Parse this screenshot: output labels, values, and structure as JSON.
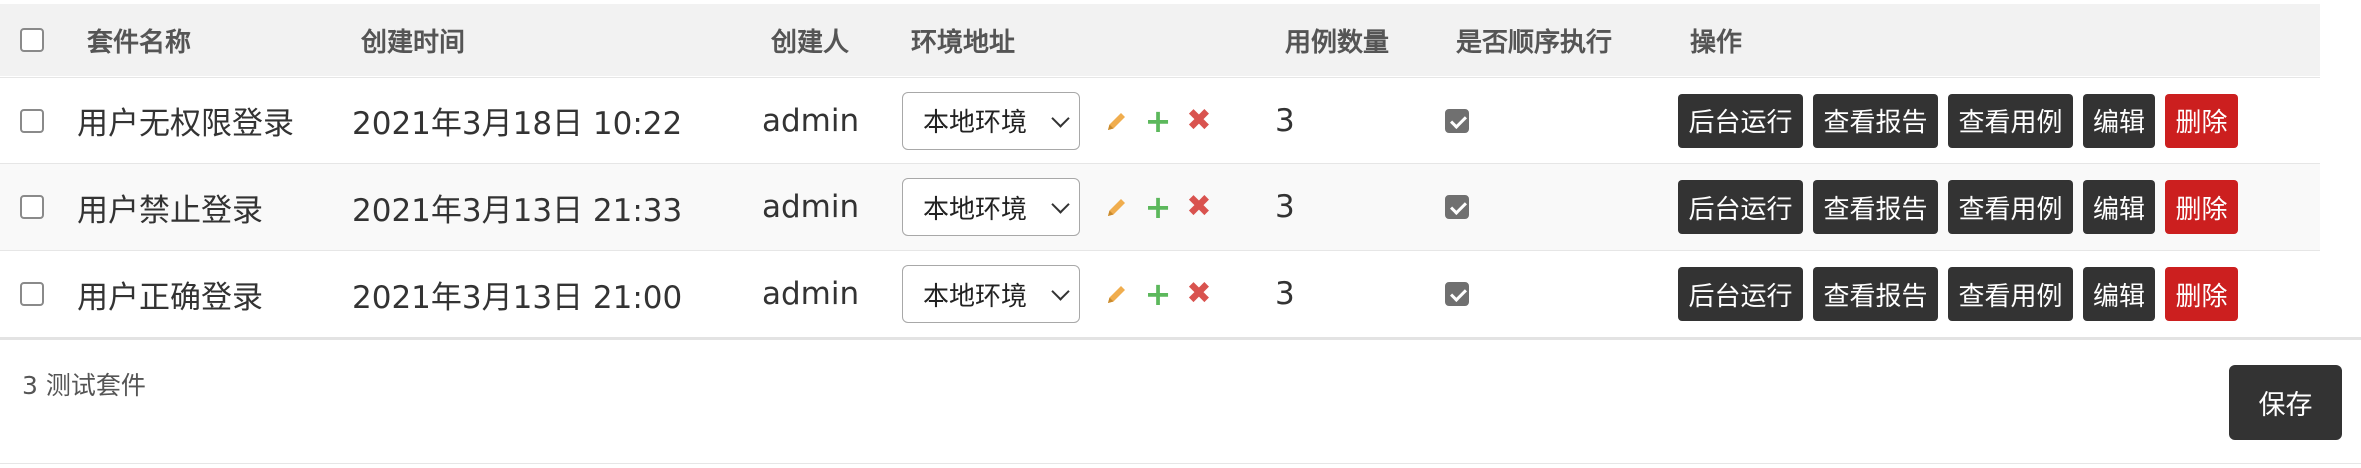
{
  "header": {
    "select_all": false,
    "columns": [
      "套件名称",
      "创建时间",
      "创建人",
      "环境地址",
      "用例数量",
      "是否顺序执行",
      "操作"
    ]
  },
  "rows": [
    {
      "selected": false,
      "name": "用户无权限登录",
      "created": "2021年3月18日 10:22",
      "creator": "admin",
      "env": "本地环境",
      "case_count": "3",
      "sequential": true
    },
    {
      "selected": false,
      "name": "用户禁止登录",
      "created": "2021年3月13日 21:33",
      "creator": "admin",
      "env": "本地环境",
      "case_count": "3",
      "sequential": true
    },
    {
      "selected": false,
      "name": "用户正确登录",
      "created": "2021年3月13日 21:00",
      "creator": "admin",
      "env": "本地环境",
      "case_count": "3",
      "sequential": true
    }
  ],
  "actions": {
    "run_background": "后台运行",
    "view_report": "查看报告",
    "view_cases": "查看用例",
    "edit": "编辑",
    "delete": "删除"
  },
  "row_icons": [
    "pencil-icon",
    "plus-icon",
    "times-icon"
  ],
  "footer": {
    "count_text": "3 测试套件",
    "save_label": "保存"
  },
  "colors": {
    "button_dark": "#333333",
    "button_danger": "#cc1f1f",
    "icon_edit": "#f0ad4e",
    "icon_add": "#5cb85c",
    "icon_remove": "#d9534f"
  }
}
